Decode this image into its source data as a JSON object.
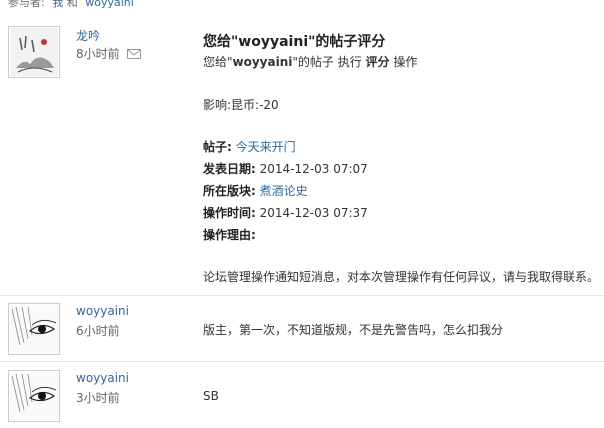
{
  "participants": {
    "label": "参与者:",
    "user1": "我",
    "conj": "和",
    "user2": "woyyaini"
  },
  "posts": [
    {
      "author": "龙吟",
      "time": "8小时前",
      "icon": "envelope-icon",
      "title_prefix": "您给\"",
      "title_user": "woyyaini",
      "title_suffix": "\"的帖子评分",
      "sub_prefix": "您给\"",
      "sub_user": "woyyaini",
      "sub_mid": "\"的帖子 执行 ",
      "sub_action": "评分",
      "sub_end": " 操作",
      "impact_label": "影响:",
      "impact_value": "昆币:-20",
      "thread_label": "帖子:",
      "thread_value": "今天来开门",
      "date_label": "发表日期:",
      "date_value": "2014-12-03 07:07",
      "forum_label": "所在版块:",
      "forum_value": "煮酒论史",
      "optime_label": "操作时间:",
      "optime_value": "2014-12-03 07:37",
      "reason_label": "操作理由:",
      "notice": "论坛管理操作通知短消息，对本次管理操作有任何异议，请与我取得联系。"
    },
    {
      "author": "woyyaini",
      "time": "6小时前",
      "message": "版主，第一次，不知道版规，不是先警告吗，怎么扣我分"
    },
    {
      "author": "woyyaini",
      "time": "3小时前",
      "message": "SB"
    }
  ]
}
